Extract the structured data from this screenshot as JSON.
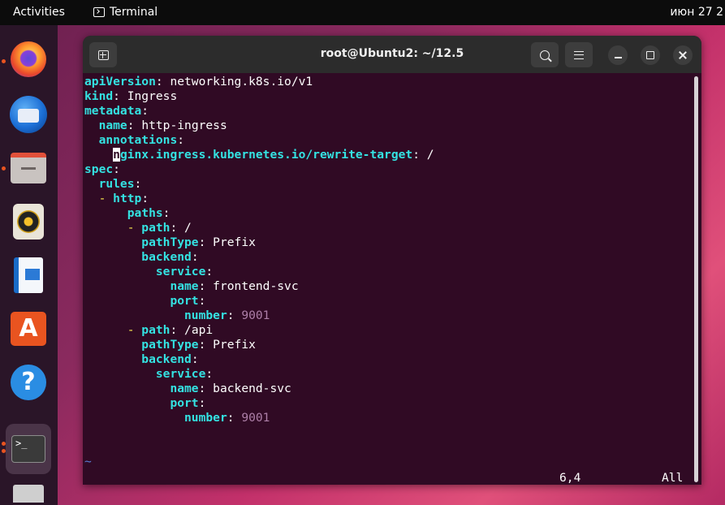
{
  "topbar": {
    "activities": "Activities",
    "app_name": "Terminal",
    "clock": "июн 27  2"
  },
  "dock": {
    "items": [
      {
        "name": "Firefox",
        "icon": "firefox-icon",
        "running": true
      },
      {
        "name": "Thunderbird",
        "icon": "thunderbird-icon",
        "running": false
      },
      {
        "name": "Files",
        "icon": "files-icon",
        "running": true
      },
      {
        "name": "Rhythmbox",
        "icon": "rhythmbox-icon",
        "running": false
      },
      {
        "name": "LibreOffice Writer",
        "icon": "writer-icon",
        "running": false
      },
      {
        "name": "Ubuntu Software",
        "icon": "software-store-icon",
        "running": false
      },
      {
        "name": "Help",
        "icon": "help-icon",
        "running": false
      },
      {
        "name": "Terminal",
        "icon": "terminal-icon",
        "running": true,
        "active": true
      },
      {
        "name": "Disks",
        "icon": "disk-icon",
        "running": false
      }
    ],
    "store_glyph": "A",
    "help_glyph": "?",
    "terminal_glyph": ">_"
  },
  "window": {
    "title": "root@Ubuntu2: ~/12.5"
  },
  "editor": {
    "lines": [
      {
        "indent": "",
        "key": "apiVersion",
        "sep": ": ",
        "value": "networking.k8s.io/v1"
      },
      {
        "indent": "",
        "key": "kind",
        "sep": ": ",
        "value": "Ingress"
      },
      {
        "indent": "",
        "key": "metadata",
        "sep": ":",
        "value": ""
      },
      {
        "indent": "  ",
        "key": "name",
        "sep": ": ",
        "value": "http-ingress"
      },
      {
        "indent": "  ",
        "key": "annotations",
        "sep": ":",
        "value": ""
      },
      {
        "indent": "    ",
        "key": "nginx.ingress.kubernetes.io/rewrite-target",
        "sep": ": ",
        "value": "/"
      },
      {
        "indent": "",
        "key": "spec",
        "sep": ":",
        "value": ""
      },
      {
        "indent": "  ",
        "key": "rules",
        "sep": ":",
        "value": ""
      },
      {
        "indent": "  ",
        "dash": "- ",
        "key": "http",
        "sep": ":",
        "value": ""
      },
      {
        "indent": "      ",
        "key": "paths",
        "sep": ":",
        "value": ""
      },
      {
        "indent": "      ",
        "dash": "- ",
        "key": "path",
        "sep": ": ",
        "value": "/"
      },
      {
        "indent": "        ",
        "key": "pathType",
        "sep": ": ",
        "value": "Prefix"
      },
      {
        "indent": "        ",
        "key": "backend",
        "sep": ":",
        "value": ""
      },
      {
        "indent": "          ",
        "key": "service",
        "sep": ":",
        "value": ""
      },
      {
        "indent": "            ",
        "key": "name",
        "sep": ": ",
        "value": "frontend-svc"
      },
      {
        "indent": "            ",
        "key": "port",
        "sep": ":",
        "value": ""
      },
      {
        "indent": "              ",
        "key": "number",
        "sep": ": ",
        "num": "9001"
      },
      {
        "indent": "      ",
        "dash": "- ",
        "key": "path",
        "sep": ": ",
        "value": "/api"
      },
      {
        "indent": "        ",
        "key": "pathType",
        "sep": ": ",
        "value": "Prefix"
      },
      {
        "indent": "        ",
        "key": "backend",
        "sep": ":",
        "value": ""
      },
      {
        "indent": "          ",
        "key": "service",
        "sep": ":",
        "value": ""
      },
      {
        "indent": "            ",
        "key": "name",
        "sep": ": ",
        "value": "backend-svc"
      },
      {
        "indent": "            ",
        "key": "port",
        "sep": ":",
        "value": ""
      },
      {
        "indent": "              ",
        "key": "number",
        "sep": ": ",
        "num": "9001"
      }
    ],
    "cursor_line": 5,
    "empty_marker": "~",
    "status_position": "6,4",
    "status_scroll": "All"
  },
  "colors": {
    "terminal_bg": "#300a24",
    "key": "#34e2e2",
    "dash": "#fce94f",
    "number": "#ad7fa8",
    "tilde": "#5a7fd6",
    "accent": "#e95420"
  }
}
